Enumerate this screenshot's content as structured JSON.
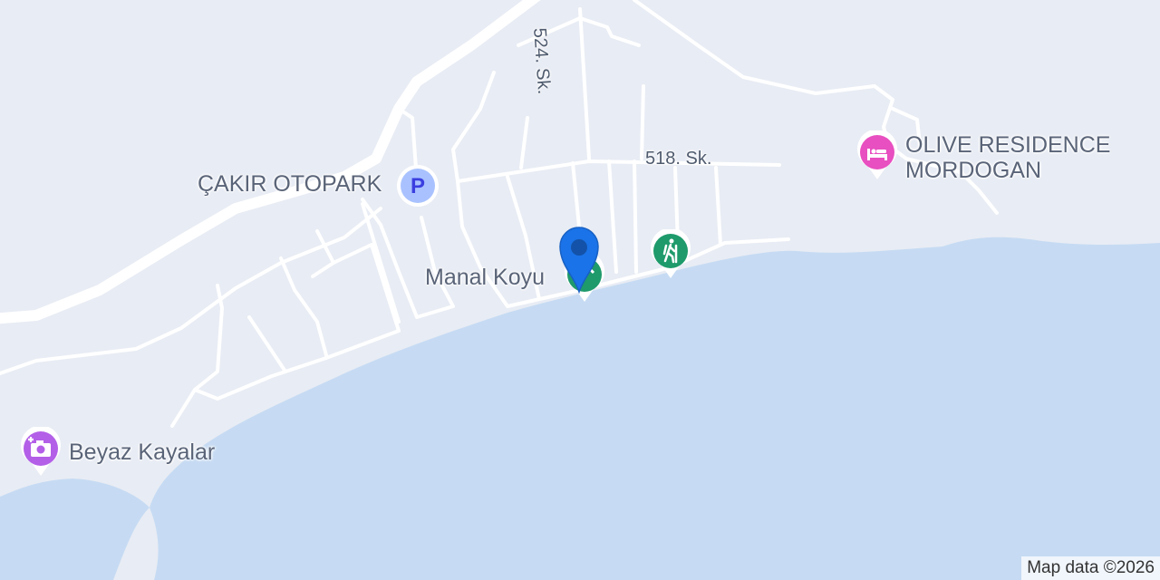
{
  "map": {
    "attribution": "Map data ©2026",
    "colors": {
      "land": "#e8ecf4",
      "water": "#c6dbf3",
      "road": "#ffffff",
      "text": "#5a6478"
    },
    "streets": [
      {
        "id": "524",
        "label": "524. Sk."
      },
      {
        "id": "518",
        "label": "518. Sk."
      }
    ],
    "pois": [
      {
        "id": "cakir",
        "name": "ÇAKIR OTOPARK",
        "icon": "parking-icon",
        "color": "#a9c2ff"
      },
      {
        "id": "manal",
        "name": "Manal Koyu",
        "icon": "beach-icon",
        "color": "#1e9a6b"
      },
      {
        "id": "hiking",
        "name": "",
        "icon": "hiking-icon",
        "color": "#1e9a6b"
      },
      {
        "id": "olive",
        "name_line1": "OLIVE RESIDENCE",
        "name_line2": "MORDOGAN",
        "icon": "hotel-icon",
        "color": "#e84fc0"
      },
      {
        "id": "beyaz",
        "name": "Beyaz Kayalar",
        "icon": "camera-icon",
        "color": "#b35fe8"
      }
    ],
    "selected_marker": {
      "icon": "location-pin-icon",
      "color": "#1a73e8"
    }
  }
}
